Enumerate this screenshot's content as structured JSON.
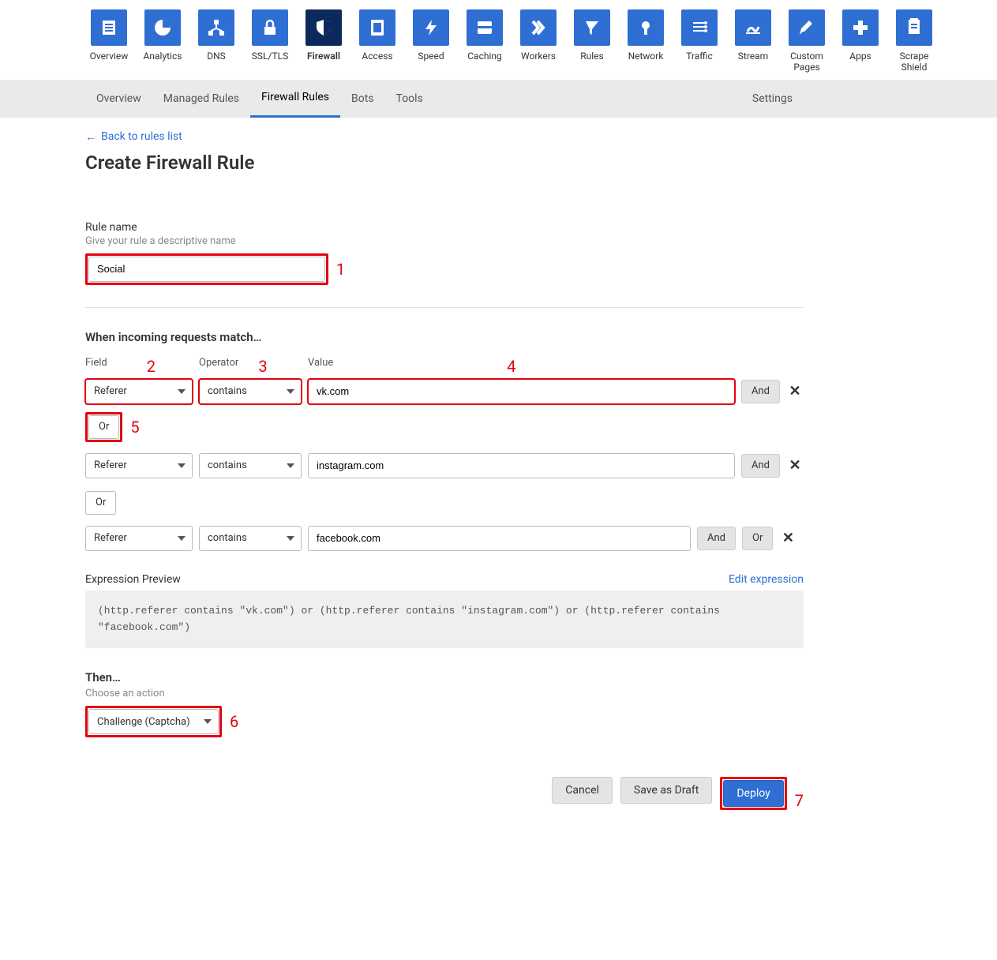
{
  "topnav": [
    {
      "label": "Overview",
      "active": false
    },
    {
      "label": "Analytics",
      "active": false
    },
    {
      "label": "DNS",
      "active": false
    },
    {
      "label": "SSL/TLS",
      "active": false
    },
    {
      "label": "Firewall",
      "active": true
    },
    {
      "label": "Access",
      "active": false
    },
    {
      "label": "Speed",
      "active": false
    },
    {
      "label": "Caching",
      "active": false
    },
    {
      "label": "Workers",
      "active": false
    },
    {
      "label": "Rules",
      "active": false
    },
    {
      "label": "Network",
      "active": false
    },
    {
      "label": "Traffic",
      "active": false
    },
    {
      "label": "Stream",
      "active": false
    },
    {
      "label": "Custom Pages",
      "active": false
    },
    {
      "label": "Apps",
      "active": false
    },
    {
      "label": "Scrape Shield",
      "active": false
    }
  ],
  "tabs": {
    "items": [
      "Overview",
      "Managed Rules",
      "Firewall Rules",
      "Bots",
      "Tools"
    ],
    "active_index": 2,
    "settings": "Settings"
  },
  "back_link": "Back to rules list",
  "page_title": "Create Firewall Rule",
  "rule_name": {
    "label": "Rule name",
    "hint": "Give your rule a descriptive name",
    "value": "Social"
  },
  "match": {
    "heading": "When incoming requests match…",
    "cols": {
      "field": "Field",
      "operator": "Operator",
      "value": "Value"
    },
    "rows": [
      {
        "field": "Referer",
        "operator": "contains",
        "value": "vk.com",
        "buttons": [
          "And"
        ],
        "hl": true
      },
      {
        "field": "Referer",
        "operator": "contains",
        "value": "instagram.com",
        "buttons": [
          "And"
        ],
        "hl": false
      },
      {
        "field": "Referer",
        "operator": "contains",
        "value": "facebook.com",
        "buttons": [
          "And",
          "Or"
        ],
        "hl": false,
        "short": true
      }
    ],
    "or_label": "Or"
  },
  "expression": {
    "label": "Expression Preview",
    "link": "Edit expression",
    "text": "(http.referer contains \"vk.com\") or (http.referer contains \"instagram.com\") or (http.referer contains \"facebook.com\")"
  },
  "then": {
    "heading": "Then…",
    "hint": "Choose an action",
    "value": "Challenge (Captcha)"
  },
  "footer": {
    "cancel": "Cancel",
    "draft": "Save as Draft",
    "deploy": "Deploy"
  },
  "annotations": {
    "a1": "1",
    "a2": "2",
    "a3": "3",
    "a4": "4",
    "a5": "5",
    "a6": "6",
    "a7": "7"
  }
}
